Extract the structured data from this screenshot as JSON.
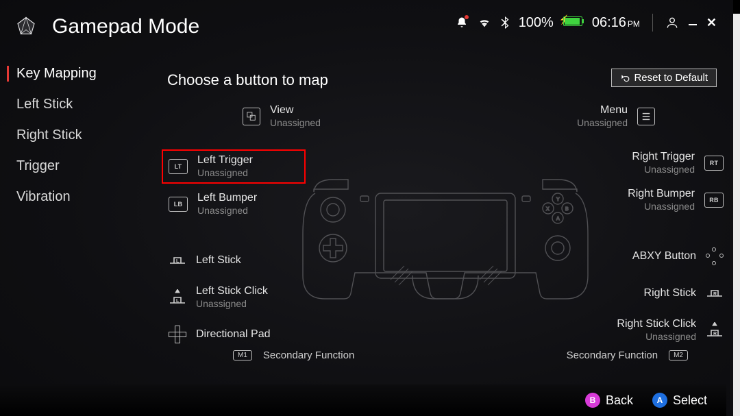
{
  "header": {
    "title": "Gamepad Mode",
    "battery_pct": "100%",
    "time": "06:16",
    "ampm": "PM"
  },
  "sidebar": {
    "items": [
      {
        "label": "Key Mapping",
        "active": true
      },
      {
        "label": "Left Stick"
      },
      {
        "label": "Right Stick"
      },
      {
        "label": "Trigger"
      },
      {
        "label": "Vibration"
      }
    ]
  },
  "main": {
    "heading": "Choose a button to map",
    "reset_label": "Reset to Default"
  },
  "left": {
    "view": {
      "label": "View",
      "sub": "Unassigned"
    },
    "lt": {
      "label": "Left Trigger",
      "sub": "Unassigned",
      "badge": "LT"
    },
    "lb": {
      "label": "Left Bumper",
      "sub": "Unassigned",
      "badge": "LB"
    },
    "ls": {
      "label": "Left Stick",
      "badge": "L"
    },
    "lsc": {
      "label": "Left Stick Click",
      "sub": "Unassigned",
      "badge": "L"
    },
    "dp": {
      "label": "Directional Pad"
    },
    "m1": {
      "label": "Secondary Function",
      "badge": "M1"
    }
  },
  "right": {
    "menu": {
      "label": "Menu",
      "sub": "Unassigned"
    },
    "rt": {
      "label": "Right Trigger",
      "sub": "Unassigned",
      "badge": "RT"
    },
    "rb": {
      "label": "Right Bumper",
      "sub": "Unassigned",
      "badge": "RB"
    },
    "abxy": {
      "label": "ABXY Button"
    },
    "rs": {
      "label": "Right Stick",
      "badge": "R"
    },
    "rsc": {
      "label": "Right Stick Click",
      "sub": "Unassigned",
      "badge": "R"
    },
    "m2": {
      "label": "Secondary Function",
      "badge": "M2"
    }
  },
  "footer": {
    "back": "Back",
    "select": "Select",
    "b": "B",
    "a": "A"
  }
}
